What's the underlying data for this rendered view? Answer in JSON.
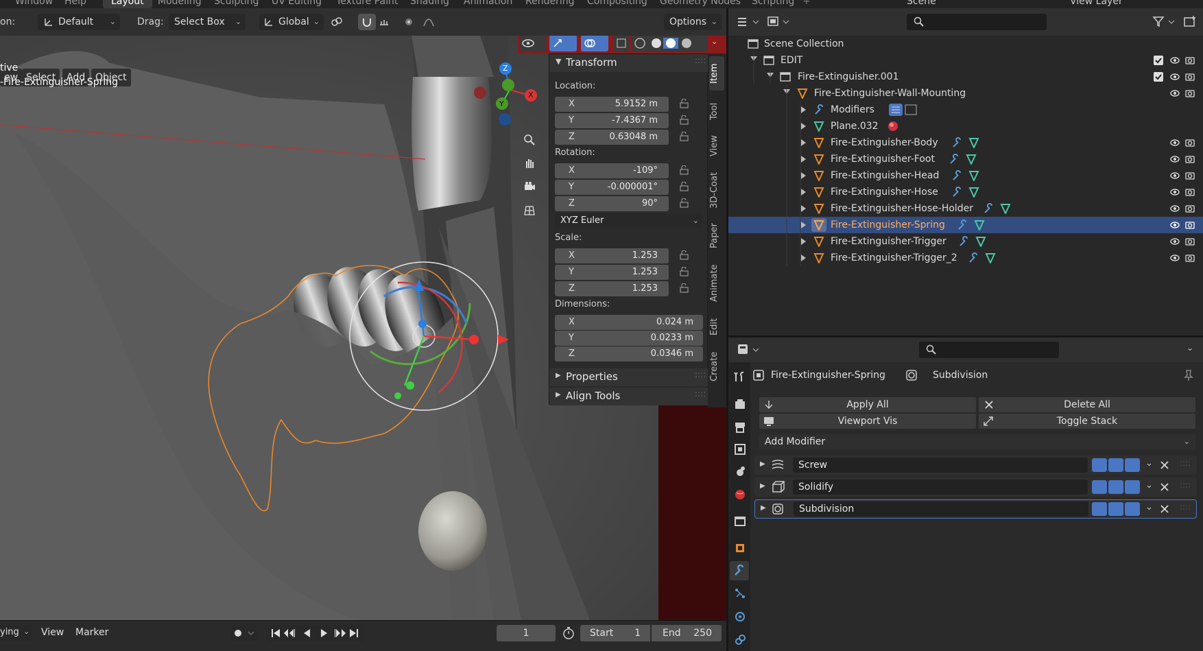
{
  "top_menu": {
    "items": [
      "Window",
      "Help",
      "Layout",
      "Modeling",
      "Sculpting",
      "UV Editing",
      "Texture Paint",
      "Shading",
      "Animation",
      "Rendering",
      "Compositing",
      "Geometry Nodes",
      "Scripting"
    ],
    "active": "Layout",
    "scene": "Scene",
    "view_layer": "View Layer"
  },
  "tool_header": {
    "orientation_label": "on:",
    "orientation_value": "Default",
    "drag_label": "Drag:",
    "drag_value": "Select Box",
    "transform_orientation": "Global",
    "options_label": "Options"
  },
  "viewport": {
    "menu": [
      "ew",
      "Select",
      "Add",
      "Object"
    ],
    "info_mode": "tive",
    "info_object": "-Fire-Extinguisher-Spring",
    "gizmo_axes": [
      "Z",
      "Y",
      "X"
    ]
  },
  "n_panel": {
    "transform_title": "Transform",
    "location_label": "Location:",
    "location": [
      {
        "axis": "X",
        "value": "5.9152 m"
      },
      {
        "axis": "Y",
        "value": "-7.4367 m"
      },
      {
        "axis": "Z",
        "value": "0.63048 m"
      }
    ],
    "rotation_label": "Rotation:",
    "rotation": [
      {
        "axis": "X",
        "value": "-109°"
      },
      {
        "axis": "Y",
        "value": "-0.000001°"
      },
      {
        "axis": "Z",
        "value": "90°"
      }
    ],
    "rotation_mode": "XYZ Euler",
    "scale_label": "Scale:",
    "scale": [
      {
        "axis": "X",
        "value": "1.253"
      },
      {
        "axis": "Y",
        "value": "1.253"
      },
      {
        "axis": "Z",
        "value": "1.253"
      }
    ],
    "dimensions_label": "Dimensions:",
    "dimensions": [
      {
        "axis": "X",
        "value": "0.024 m"
      },
      {
        "axis": "Y",
        "value": "0.0233 m"
      },
      {
        "axis": "Z",
        "value": "0.0346 m"
      }
    ],
    "properties_title": "Properties",
    "align_tools_title": "Align Tools",
    "tabs": [
      "Item",
      "Tool",
      "View",
      "3D-Coat",
      "Paper",
      "Animate",
      "Edit",
      "Create"
    ]
  },
  "timeline": {
    "playback": "ying",
    "view": "View",
    "marker": "Marker",
    "current_frame": "1",
    "start_label": "Start",
    "start": "1",
    "end_label": "End",
    "end": "250"
  },
  "outliner": {
    "rows": [
      {
        "name": "Scene Collection",
        "type": "scene"
      },
      {
        "name": "EDIT",
        "type": "collection"
      },
      {
        "name": "Fire-Extinguisher.001",
        "type": "collection"
      },
      {
        "name": "Fire-Extinguisher-Wall-Mounting",
        "type": "mesh"
      },
      {
        "name": "Modifiers",
        "type": "modifiers"
      },
      {
        "name": "Plane.032",
        "type": "meshdata"
      },
      {
        "name": "Fire-Extinguisher-Body",
        "type": "mesh"
      },
      {
        "name": "Fire-Extinguisher-Foot",
        "type": "mesh"
      },
      {
        "name": "Fire-Extinguisher-Head",
        "type": "mesh"
      },
      {
        "name": "Fire-Extinguisher-Hose",
        "type": "mesh"
      },
      {
        "name": "Fire-Extinguisher-Hose-Holder",
        "type": "mesh"
      },
      {
        "name": "Fire-Extinguisher-Spring",
        "type": "mesh",
        "selected": true
      },
      {
        "name": "Fire-Extinguisher-Trigger",
        "type": "mesh"
      },
      {
        "name": "Fire-Extinguisher-Trigger_2",
        "type": "mesh"
      }
    ]
  },
  "properties": {
    "object_name": "Fire-Extinguisher-Spring",
    "modifier_context": "Subdivision",
    "apply_all": "Apply All",
    "delete_all": "Delete All",
    "viewport_vis": "Viewport Vis",
    "toggle_stack": "Toggle Stack",
    "add_modifier": "Add Modifier",
    "modifiers": [
      "Screw",
      "Solidify",
      "Subdivision"
    ]
  },
  "colors": {
    "accent": "#4a77c4",
    "selection": "#334d80",
    "outline_orange": "#e8892b"
  }
}
